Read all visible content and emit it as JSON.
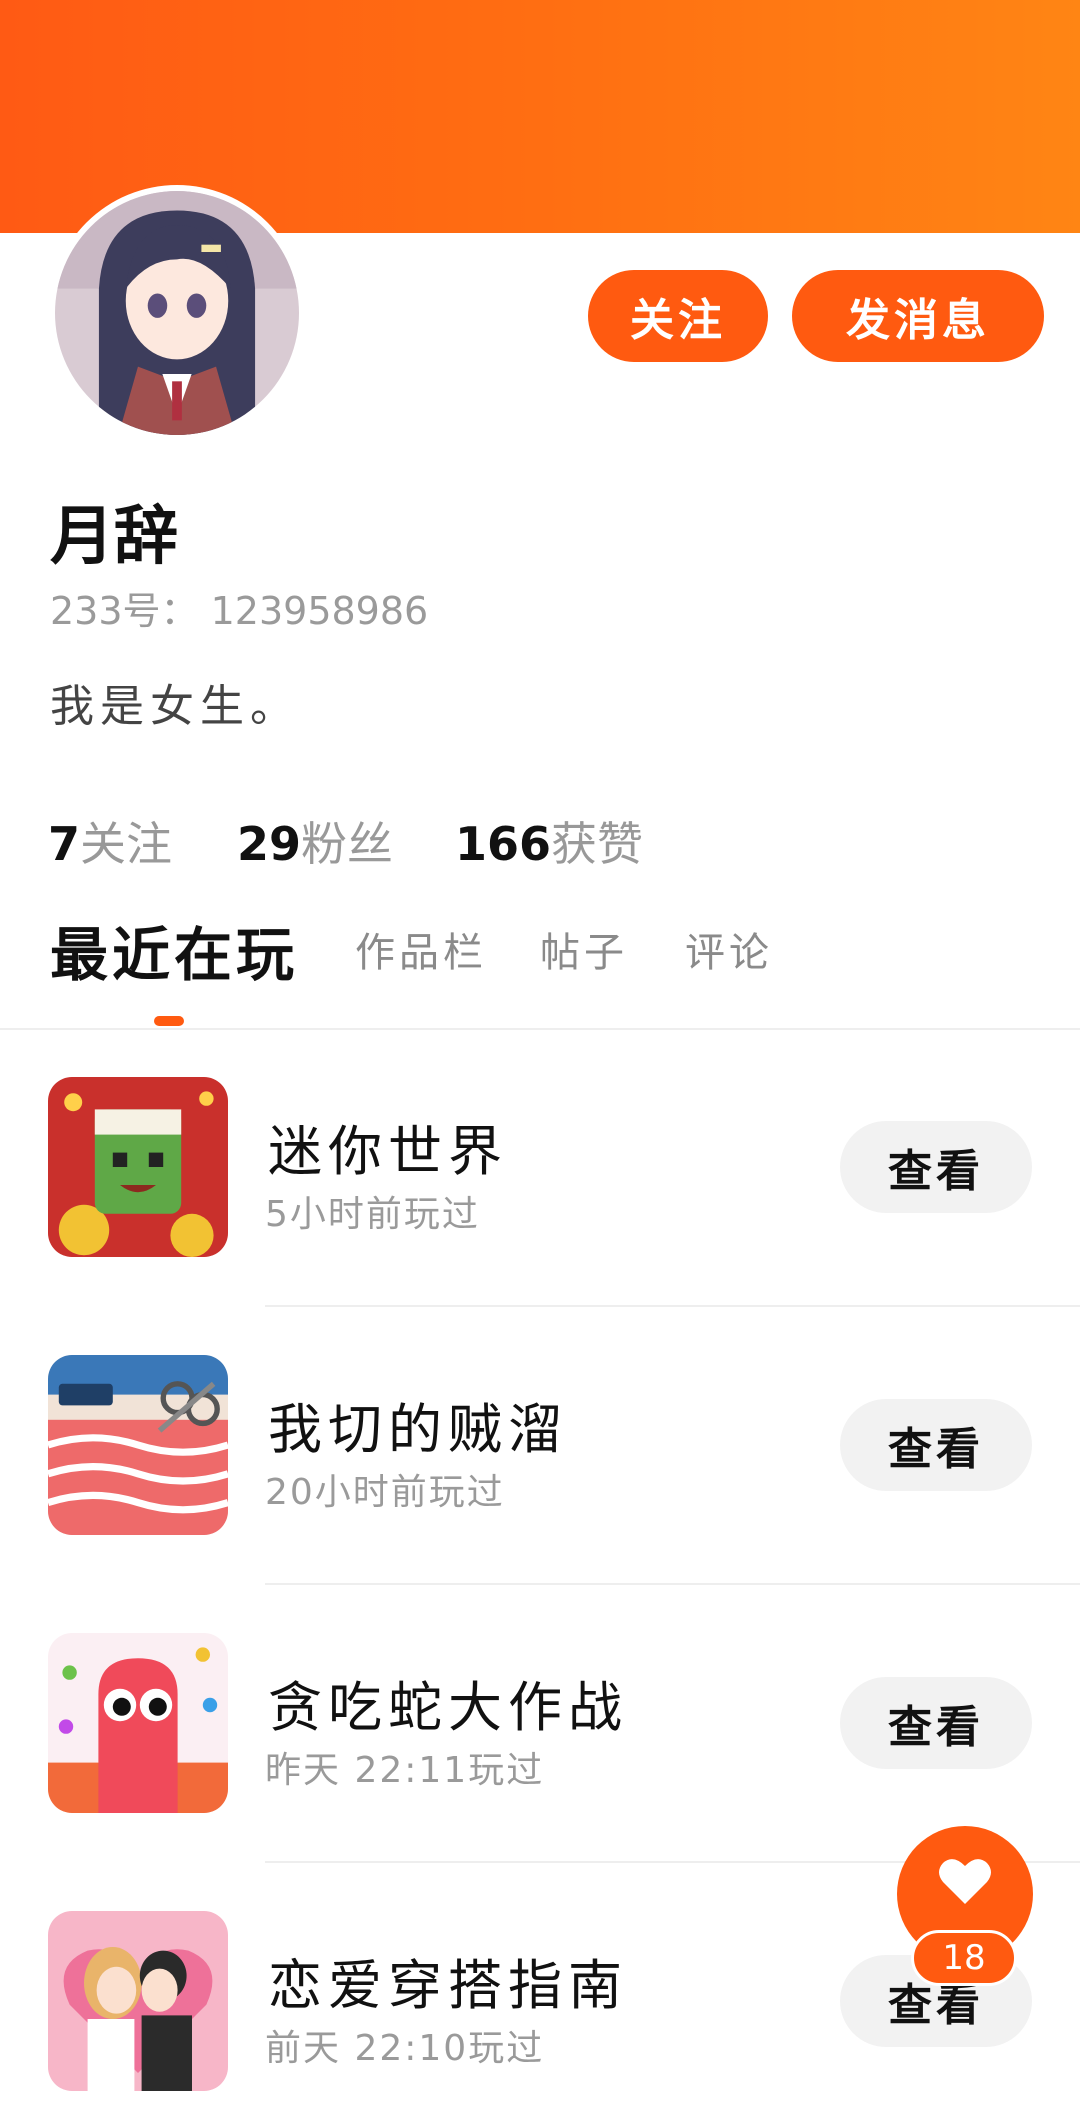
{
  "profile": {
    "nickname": "月辞",
    "uid": "233号： 123958986",
    "bio": "我是女生。",
    "follow_label": "关注",
    "message_label": "发消息"
  },
  "stats": [
    {
      "num": "7",
      "label": "关注"
    },
    {
      "num": "29",
      "label": "粉丝"
    },
    {
      "num": "166",
      "label": "获赞"
    }
  ],
  "tabs": [
    {
      "label": "最近在玩",
      "active": true
    },
    {
      "label": "作品栏"
    },
    {
      "label": "帖子"
    },
    {
      "label": "评论"
    }
  ],
  "games": [
    {
      "title": "迷你世界",
      "time": "5小时前玩过",
      "action": "查看",
      "icon": "mini-world-icon"
    },
    {
      "title": "我切的贼溜",
      "time": "20小时前玩过",
      "action": "查看",
      "icon": "meat-cutting-icon"
    },
    {
      "title": "贪吃蛇大作战",
      "time": "昨天 22:11玩过",
      "action": "查看",
      "icon": "snake-icon"
    },
    {
      "title": "恋爱穿搭指南",
      "time": "前天 22:10玩过",
      "action": "查看",
      "icon": "romance-dressup-icon"
    }
  ],
  "like_fab": {
    "count": "18",
    "icon": "heart-icon"
  },
  "colors": {
    "accent": "#ff5a10",
    "banner_start": "#ff5a14",
    "banner_end": "#ff8514"
  }
}
